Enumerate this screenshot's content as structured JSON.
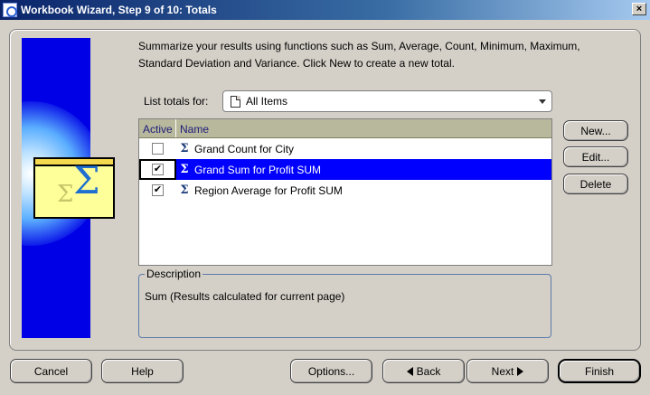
{
  "window": {
    "title": "Workbook Wizard, Step 9 of 10: Totals",
    "close_label": "×"
  },
  "intro_text": "Summarize your results using functions such as Sum, Average, Count, Minimum, Maximum, Standard Deviation and Variance. Click New to create a new total.",
  "list_totals": {
    "label": "List totals for:",
    "selected": "All Items"
  },
  "table": {
    "headers": {
      "active": "Active",
      "name": "Name"
    },
    "rows": [
      {
        "active": false,
        "check": "",
        "name": "Grand Count for City"
      },
      {
        "active": true,
        "check": "✔",
        "name": "Grand Sum for Profit SUM"
      },
      {
        "active": true,
        "check": "✔",
        "name": "Region Average for Profit SUM"
      }
    ],
    "selected_index": 1
  },
  "description": {
    "legend": "Description",
    "text": "Sum (Results calculated for current page)"
  },
  "side_buttons": {
    "new": "New...",
    "edit": "Edit...",
    "delete": "Delete"
  },
  "bottom_buttons": {
    "cancel": "Cancel",
    "help": "Help",
    "options": "Options...",
    "back": "Back",
    "next": "Next",
    "finish": "Finish"
  },
  "icons": {
    "row_icon": "sigma-icon",
    "sigma_glyph": "Σ"
  },
  "colors": {
    "selection": "#0000ff",
    "art_background": "#0000e6",
    "titlebar": "#0a246a"
  }
}
